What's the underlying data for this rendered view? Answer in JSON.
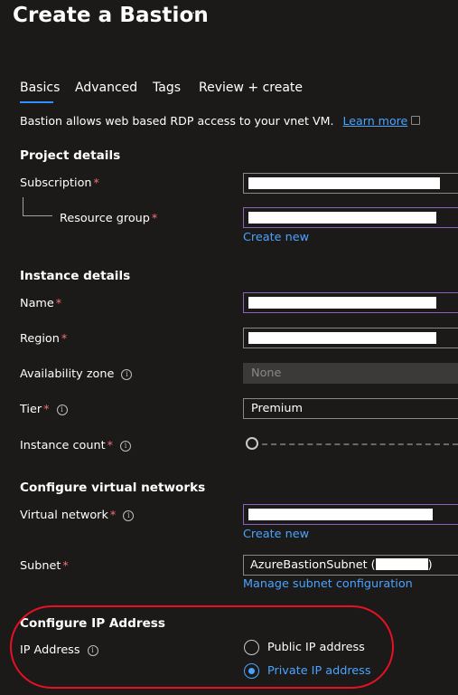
{
  "header": {
    "title": "Create a Bastion",
    "more": "···"
  },
  "tabs": [
    {
      "label": "Basics"
    },
    {
      "label": "Advanced"
    },
    {
      "label": "Tags"
    },
    {
      "label": "Review + create"
    }
  ],
  "description": {
    "text": "Bastion allows web based RDP access to your vnet VM.",
    "link": "Learn more"
  },
  "project": {
    "heading": "Project details",
    "subscription_label": "Subscription",
    "resource_group_label": "Resource group",
    "create_new": "Create new"
  },
  "instance": {
    "heading": "Instance details",
    "name_label": "Name",
    "region_label": "Region",
    "zone_label": "Availability zone",
    "zone_value": "None",
    "tier_label": "Tier",
    "tier_value": "Premium",
    "count_label": "Instance count"
  },
  "vnet": {
    "heading": "Configure virtual networks",
    "network_label": "Virtual network",
    "create_new": "Create new",
    "subnet_label": "Subnet",
    "subnet_value_prefix": "AzureBastionSubnet (",
    "subnet_value_suffix": ")",
    "manage_link": "Manage subnet configuration"
  },
  "ip": {
    "heading": "Configure IP Address",
    "label": "IP Address",
    "options": [
      "Public IP address",
      "Private IP address"
    ],
    "selected": "Private IP address"
  },
  "colors": {
    "accent": "#4aa3ff",
    "required": "#f1707b",
    "highlight": "#e81123"
  }
}
